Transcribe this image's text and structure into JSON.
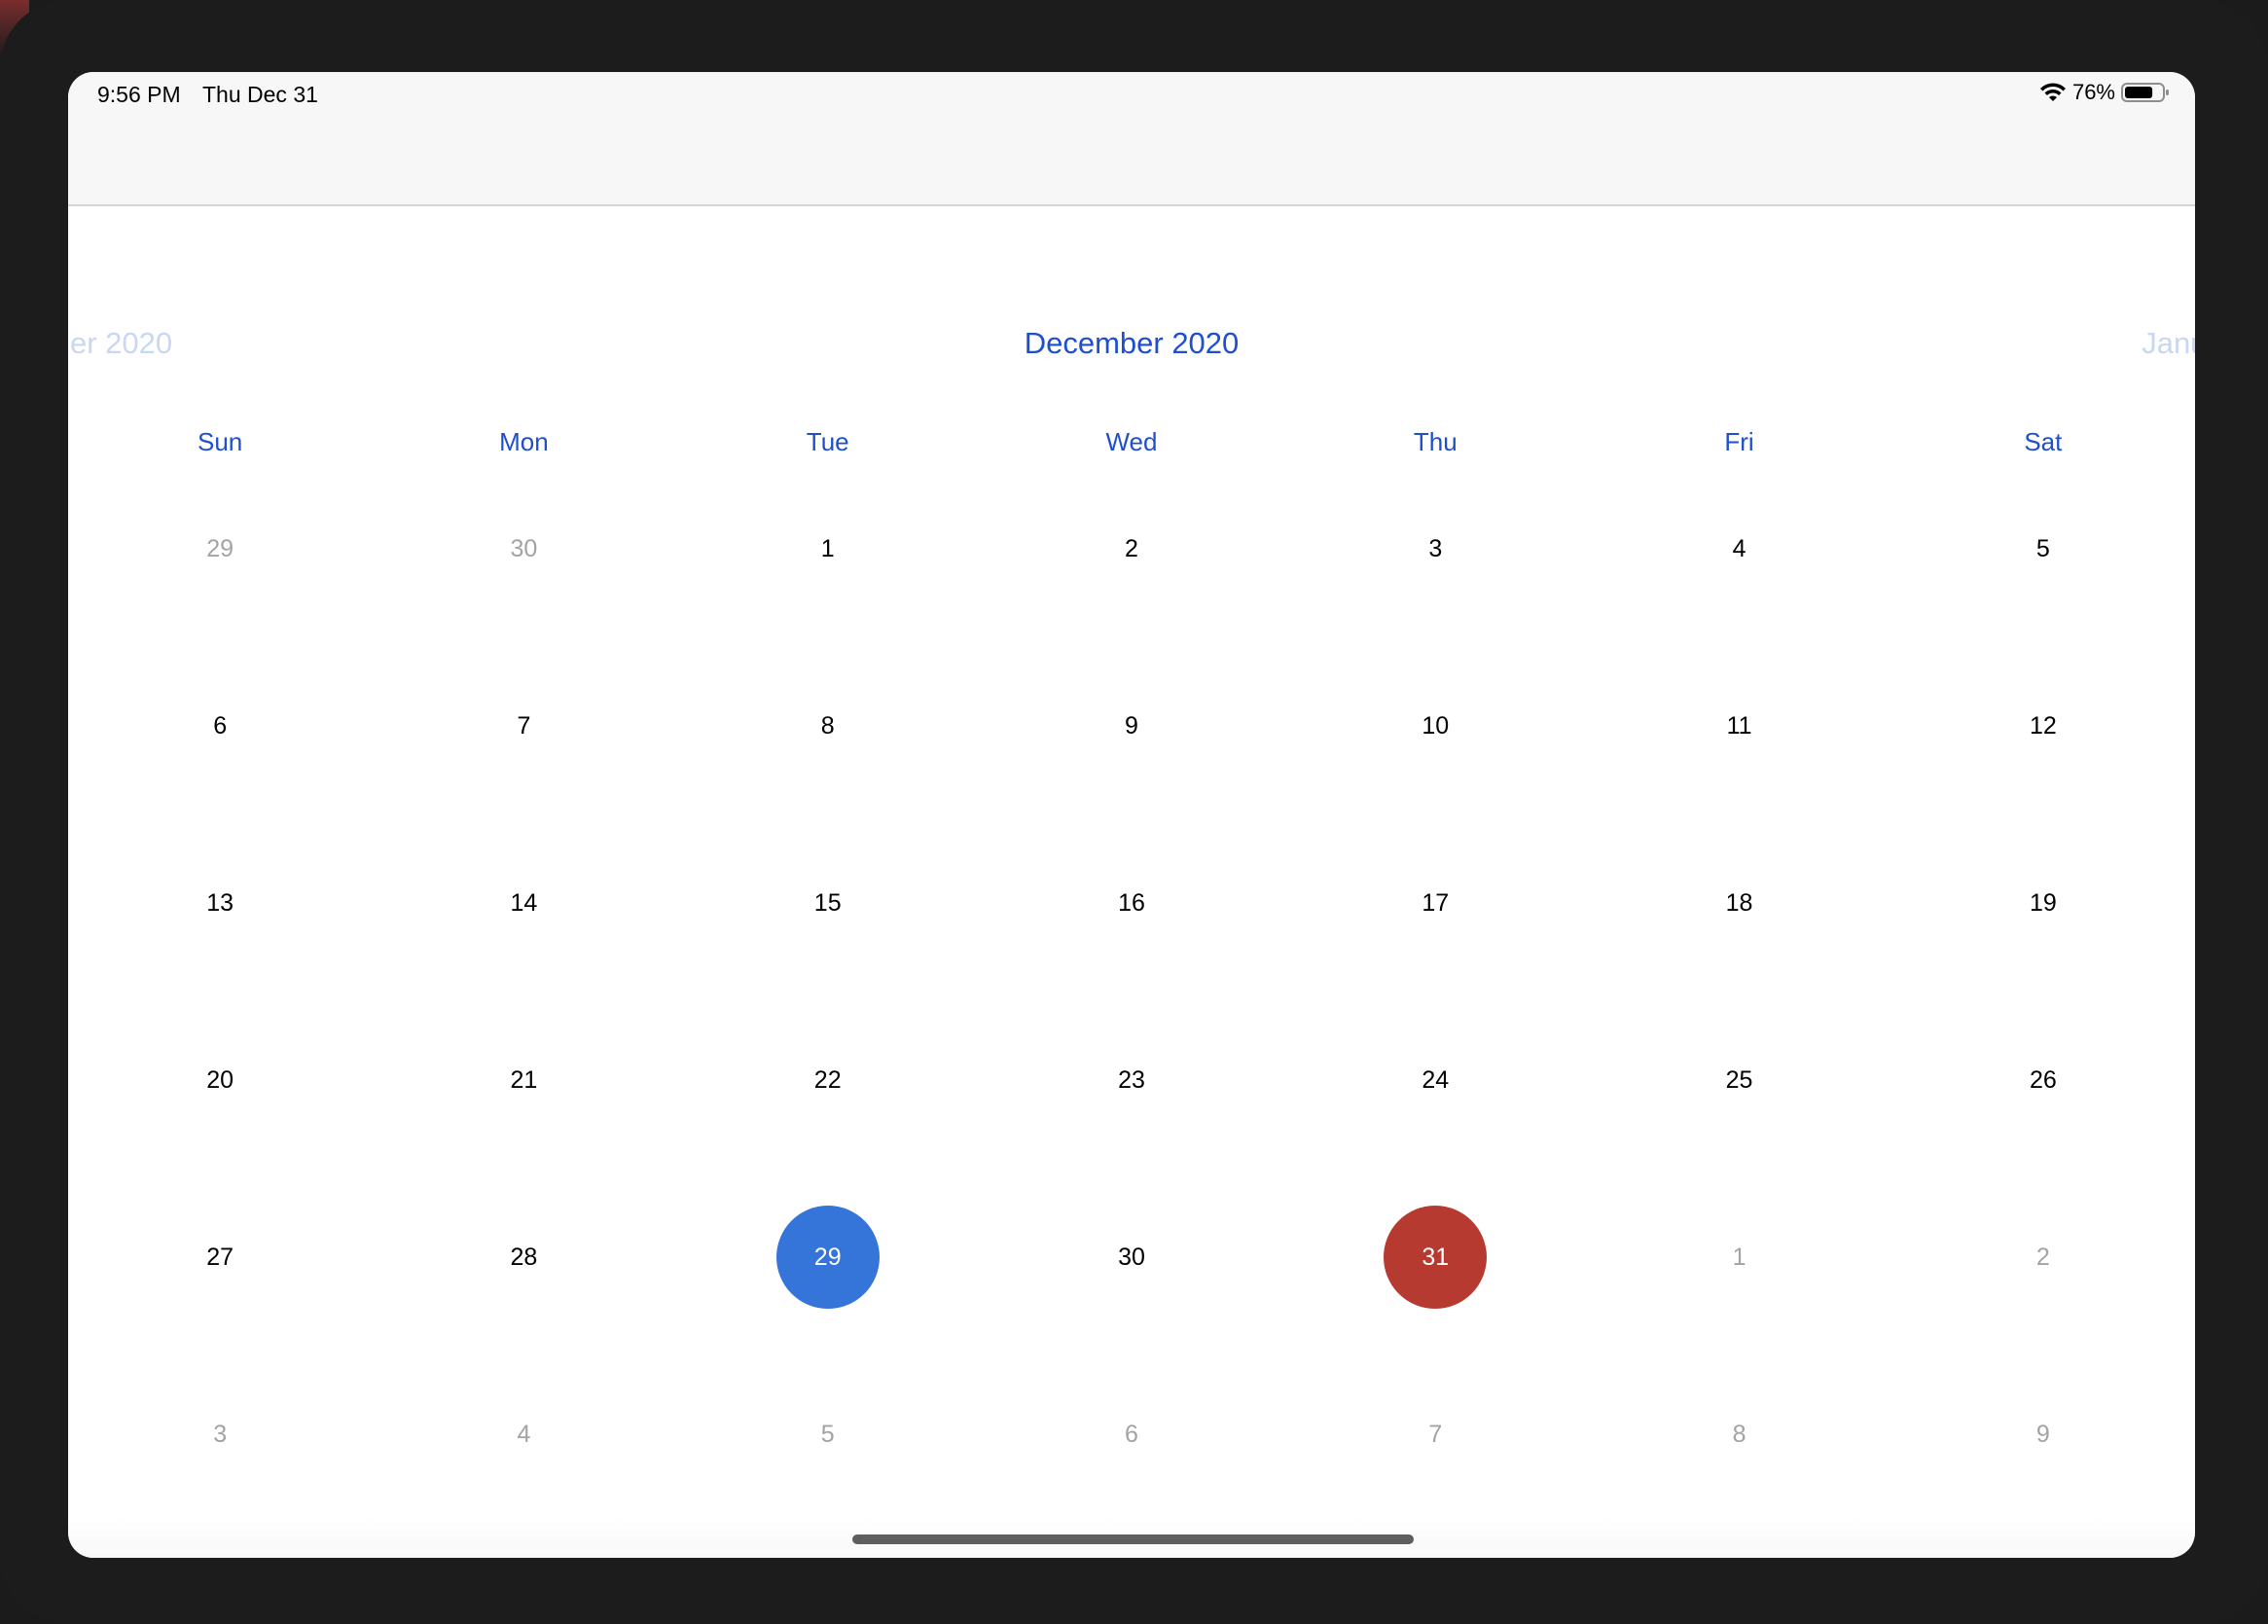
{
  "status_bar": {
    "time": "9:56 PM",
    "date": "Thu Dec 31",
    "battery_percent": "76%",
    "battery_level": 0.76,
    "wifi_icon": "wifi-icon",
    "battery_icon": "battery-icon"
  },
  "calendar": {
    "prev_month_label": "er 2020",
    "current_month_label": "December 2020",
    "next_month_label": "Januar",
    "weekdays": [
      "Sun",
      "Mon",
      "Tue",
      "Wed",
      "Thu",
      "Fri",
      "Sat"
    ],
    "weeks": [
      [
        {
          "d": "29",
          "out": true
        },
        {
          "d": "30",
          "out": true
        },
        {
          "d": "1"
        },
        {
          "d": "2"
        },
        {
          "d": "3"
        },
        {
          "d": "4"
        },
        {
          "d": "5"
        }
      ],
      [
        {
          "d": "6"
        },
        {
          "d": "7"
        },
        {
          "d": "8"
        },
        {
          "d": "9"
        },
        {
          "d": "10"
        },
        {
          "d": "11"
        },
        {
          "d": "12"
        }
      ],
      [
        {
          "d": "13"
        },
        {
          "d": "14"
        },
        {
          "d": "15"
        },
        {
          "d": "16"
        },
        {
          "d": "17"
        },
        {
          "d": "18"
        },
        {
          "d": "19"
        }
      ],
      [
        {
          "d": "20"
        },
        {
          "d": "21"
        },
        {
          "d": "22"
        },
        {
          "d": "23"
        },
        {
          "d": "24"
        },
        {
          "d": "25"
        },
        {
          "d": "26"
        }
      ],
      [
        {
          "d": "27"
        },
        {
          "d": "28"
        },
        {
          "d": "29",
          "state": "selected"
        },
        {
          "d": "30"
        },
        {
          "d": "31",
          "state": "today"
        },
        {
          "d": "1",
          "out": true
        },
        {
          "d": "2",
          "out": true
        }
      ],
      [
        {
          "d": "3",
          "out": true
        },
        {
          "d": "4",
          "out": true
        },
        {
          "d": "5",
          "out": true
        },
        {
          "d": "6",
          "out": true
        },
        {
          "d": "7",
          "out": true
        },
        {
          "d": "8",
          "out": true
        },
        {
          "d": "9",
          "out": true
        }
      ]
    ],
    "colors": {
      "accent": "#1f4fcf",
      "selected": "#3574d8",
      "today": "#b73a30",
      "faded_month": "#c9d7f3",
      "out_of_month": "#a3a3a3"
    }
  }
}
